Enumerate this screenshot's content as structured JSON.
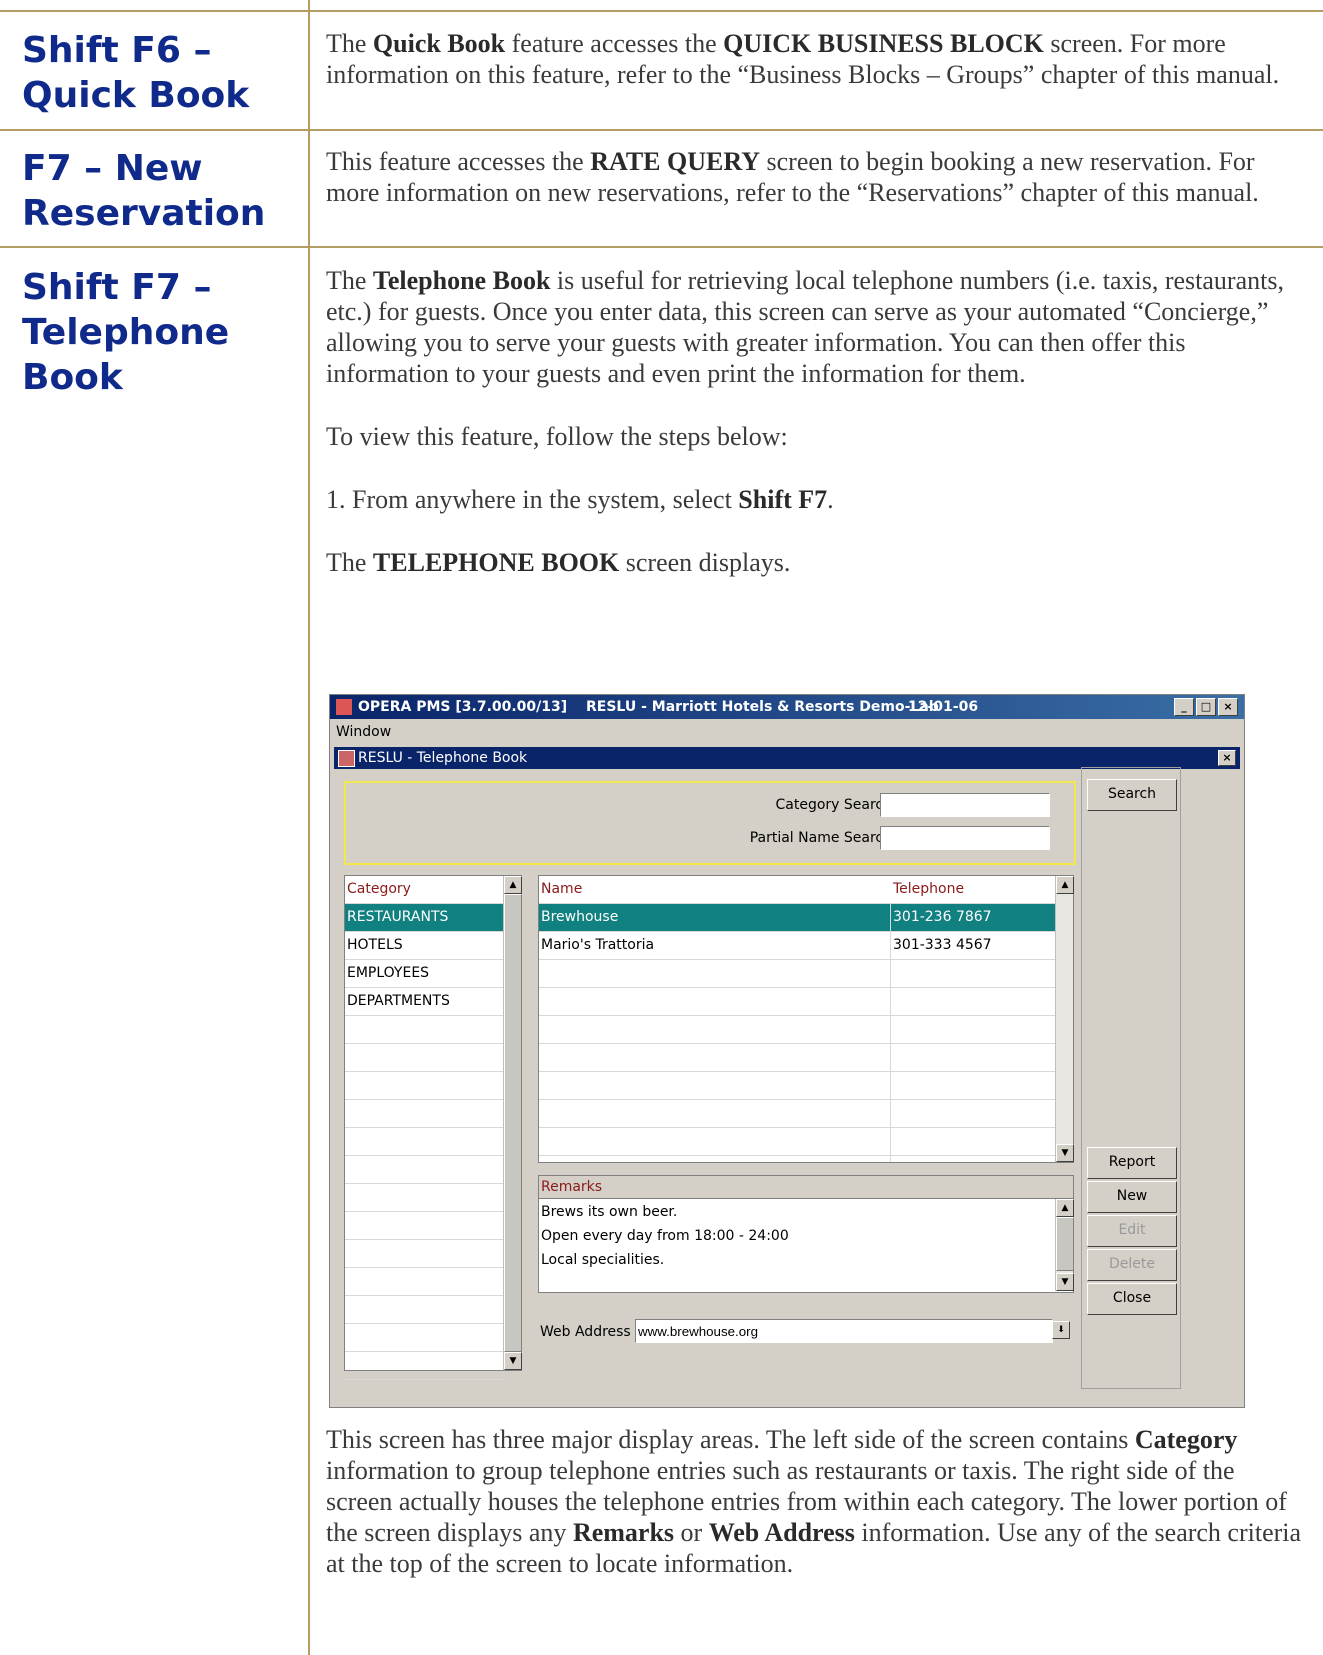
{
  "sections": [
    {
      "heading": [
        "Shift F6 –",
        "Quick Book"
      ],
      "text_runs": [
        {
          "t": "The ",
          "b": false
        },
        {
          "t": "Quick Book",
          "b": true
        },
        {
          "t": " feature accesses the ",
          "b": false
        },
        {
          "t": "QUICK BUSINESS BLOCK",
          "b": true
        },
        {
          "t": " screen. For more information on this feature, refer to the “Business Blocks – Groups” chapter of this manual.",
          "b": false
        }
      ]
    },
    {
      "heading": [
        "F7 – New",
        "Reservation"
      ],
      "text_runs": [
        {
          "t": "This feature accesses the ",
          "b": false
        },
        {
          "t": "RATE QUERY",
          "b": true
        },
        {
          "t": " screen to begin booking a new reservation.  For more information on new reservations, refer to the “Reservations” chapter of this manual.",
          "b": false
        }
      ]
    },
    {
      "heading": [
        "Shift F7 –",
        "Telephone",
        "Book"
      ],
      "paragraphs": [
        [
          {
            "t": "The ",
            "b": false
          },
          {
            "t": "Telephone Book",
            "b": true
          },
          {
            "t": " is useful for retrieving local telephone numbers (i.e. taxis, restaurants, etc.) for guests.  Once you enter data, this screen can serve as your automated “Concierge,” allowing you to serve your guests with greater information.  You can then offer this information to your guests and even print the information for them.",
            "b": false
          }
        ],
        [
          {
            "t": "To view this feature, follow the steps below:",
            "b": false
          }
        ],
        [
          {
            "t": "1.   From anywhere in the system, select ",
            "b": false
          },
          {
            "t": "Shift F7",
            "b": true
          },
          {
            "t": ".",
            "b": false
          }
        ],
        [
          {
            "t": "The ",
            "b": false
          },
          {
            "t": "TELEPHONE BOOK",
            "b": true
          },
          {
            "t": " screen displays.",
            "b": false
          }
        ]
      ],
      "after": [
        {
          "t": "This screen has three major display areas.  The left side of the screen contains ",
          "b": false
        },
        {
          "t": "Category",
          "b": true
        },
        {
          "t": " information to group telephone entries such as restaurants or taxis.  The right side of the screen actually houses the telephone entries from within each category.  The lower portion of the screen displays any ",
          "b": false
        },
        {
          "t": "Remarks",
          "b": true
        },
        {
          "t": " or ",
          "b": false
        },
        {
          "t": "Web Address",
          "b": true
        },
        {
          "t": " information.  Use any of the search criteria at the top of the screen to locate information.",
          "b": false
        }
      ]
    }
  ],
  "screenshot": {
    "app_title": "OPERA PMS [3.7.00.00/13]",
    "property": "RESLU - Marriott Hotels & Resorts Demo-Lab",
    "date": "12-01-06",
    "menu": "Window",
    "window_title": "RESLU - Telephone Book",
    "category_search_label": "Category Search",
    "partial_name_label": "Partial Name Search",
    "category_search_value": "",
    "partial_name_value": "",
    "category_header": "Category",
    "categories": [
      "RESTAURANTS",
      "HOTELS",
      "EMPLOYEES",
      "DEPARTMENTS"
    ],
    "name_header": "Name",
    "phone_header": "Telephone",
    "entries": [
      {
        "name": "Brewhouse",
        "phone": "301-236 7867"
      },
      {
        "name": "Mario's Trattoria",
        "phone": "301-333 4567"
      }
    ],
    "remarks_header": "Remarks",
    "remarks": [
      "Brews its own beer.",
      "Open every day from 18:00 - 24:00",
      "Local specialities."
    ],
    "web_label": "Web Address",
    "web_value": "www.brewhouse.org",
    "buttons": {
      "search": "Search",
      "report": "Report",
      "new": "New",
      "edit": "Edit",
      "delete": "Delete",
      "close": "Close"
    },
    "colors": {
      "selection": "#108080",
      "titlebar": "#0a246a",
      "search_border": "#f2e84a",
      "header_text": "#8b1a1a"
    }
  }
}
